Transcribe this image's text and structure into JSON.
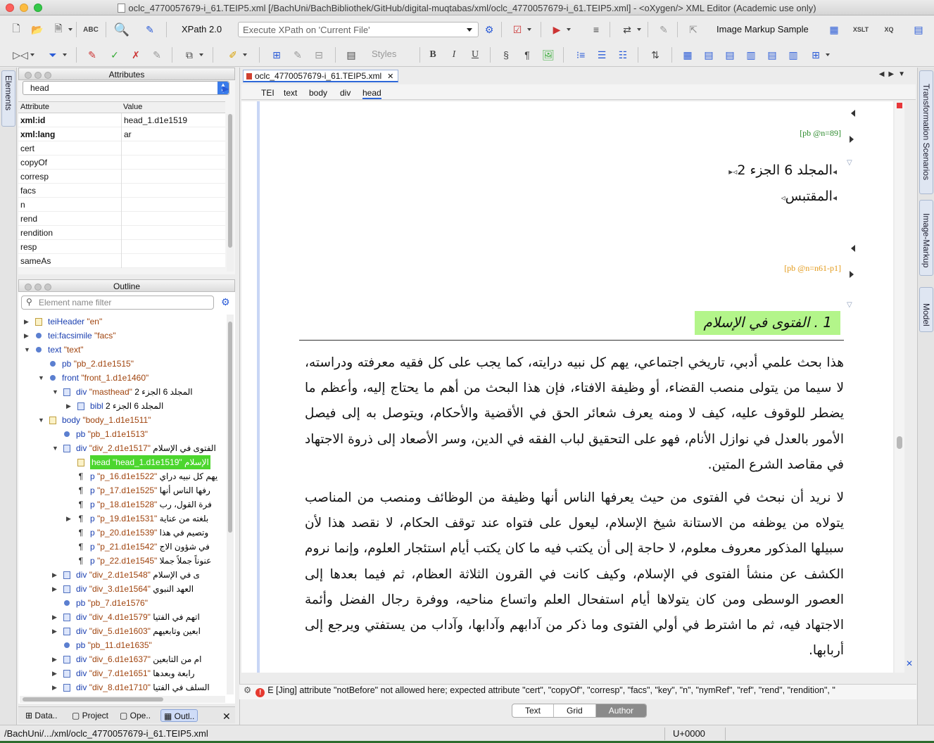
{
  "window": {
    "title": "oclc_4770057679-i_61.TEIP5.xml [/BachUni/BachBibliothek/GitHub/digital-muqtabas/xml/oclc_4770057679-i_61.TEIP5.xml] - <oXygen/> XML Editor (Academic use only)"
  },
  "toolbar": {
    "xpath_version": "XPath 2.0",
    "xpath_placeholder": "Execute XPath on  'Current File'",
    "image_markup": "Image Markup Sample",
    "styles": "Styles"
  },
  "side_tabs": {
    "left": "Elements",
    "right": [
      "Transformation Scenarios",
      "Image-Markup",
      "Model"
    ]
  },
  "attributes_panel": {
    "title": "Attributes",
    "element": "head",
    "columns": [
      "Attribute",
      "Value"
    ],
    "rows": [
      {
        "name": "xml:id",
        "value": "head_1.d1e1519",
        "set": true
      },
      {
        "name": "xml:lang",
        "value": "ar",
        "set": true
      },
      {
        "name": "cert",
        "value": "",
        "set": false
      },
      {
        "name": "copyOf",
        "value": "",
        "set": false
      },
      {
        "name": "corresp",
        "value": "",
        "set": false
      },
      {
        "name": "facs",
        "value": "",
        "set": false
      },
      {
        "name": "n",
        "value": "",
        "set": false
      },
      {
        "name": "rend",
        "value": "",
        "set": false
      },
      {
        "name": "rendition",
        "value": "",
        "set": false
      },
      {
        "name": "resp",
        "value": "",
        "set": false
      },
      {
        "name": "sameAs",
        "value": "",
        "set": false
      }
    ]
  },
  "outline_panel": {
    "title": "Outline",
    "filter_placeholder": "Element name filter",
    "items": [
      {
        "twist": "▶",
        "icon": "elem-y",
        "name": "teiHeader",
        "val": "\"en\"",
        "ar": ""
      },
      {
        "twist": "▶",
        "icon": "dot",
        "name": "tei:facsimile",
        "val": "\"facs\"",
        "ar": ""
      },
      {
        "twist": "▼",
        "icon": "dot",
        "name": "text",
        "val": "\"text\"",
        "ar": ""
      },
      {
        "twist": "",
        "icon": "dot",
        "name": "pb",
        "val": "\"pb_2.d1e1515\"",
        "ar": ""
      },
      {
        "twist": "▼",
        "icon": "dot",
        "name": "front",
        "val": "\"front_1.d1e1460\"",
        "ar": ""
      },
      {
        "twist": "▼",
        "icon": "elem",
        "name": "div",
        "val": "\"masthead\"",
        "ar": "المجلد 6 الجزء 2"
      },
      {
        "twist": "▶",
        "icon": "elem",
        "name": "bibl",
        "val": "",
        "ar": "المجلد 6 الجزء 2"
      },
      {
        "twist": "▼",
        "icon": "elem-y",
        "name": "body",
        "val": "\"body_1.d1e1511\"",
        "ar": ""
      },
      {
        "twist": "",
        "icon": "dot",
        "name": "pb",
        "val": "\"pb_1.d1e1513\"",
        "ar": ""
      },
      {
        "twist": "▼",
        "icon": "elem",
        "name": "div",
        "val": "\"div_2.d1e1517\"",
        "ar": "الفتوى في الإسلام"
      },
      {
        "twist": "",
        "icon": "elem-y",
        "name": "head",
        "val": "\"head_1.d1e1519\"",
        "ar": "الإسلام",
        "selected": true
      },
      {
        "twist": "",
        "icon": "para",
        "name": "p",
        "val": "\"p_16.d1e1522\"",
        "ar": "يهم كل نبيه دراي"
      },
      {
        "twist": "",
        "icon": "para",
        "name": "p",
        "val": "\"p_17.d1e1525\"",
        "ar": "رفها الناس أنها"
      },
      {
        "twist": "",
        "icon": "para",
        "name": "p",
        "val": "\"p_18.d1e1528\"",
        "ar": "فرة القول، رب"
      },
      {
        "twist": "▶",
        "icon": "para",
        "name": "p",
        "val": "\"p_19.d1e1531\"",
        "ar": "بلغته من عناية"
      },
      {
        "twist": "",
        "icon": "para",
        "name": "p",
        "val": "\"p_20.d1e1539\"",
        "ar": "وتصيم في هذا"
      },
      {
        "twist": "",
        "icon": "para",
        "name": "p",
        "val": "\"p_21.d1e1542\"",
        "ar": "في شؤون الاج"
      },
      {
        "twist": "",
        "icon": "para",
        "name": "p",
        "val": "\"p_22.d1e1545\"",
        "ar": "عنوناً جملاً جملا"
      },
      {
        "twist": "▶",
        "icon": "elem",
        "name": "div",
        "val": "\"div_2.d1e1548\"",
        "ar": "ى في الإسلام"
      },
      {
        "twist": "▶",
        "icon": "elem",
        "name": "div",
        "val": "\"div_3.d1e1564\"",
        "ar": "العهد النبوي"
      },
      {
        "twist": "",
        "icon": "dot",
        "name": "pb",
        "val": "\"pb_7.d1e1576\"",
        "ar": ""
      },
      {
        "twist": "▶",
        "icon": "elem",
        "name": "div",
        "val": "\"div_4.d1e1579\"",
        "ar": "اتهم في الفتيا"
      },
      {
        "twist": "▶",
        "icon": "elem",
        "name": "div",
        "val": "\"div_5.d1e1603\"",
        "ar": "ابعين وتابعيهم"
      },
      {
        "twist": "",
        "icon": "dot",
        "name": "pb",
        "val": "\"pb_11.d1e1635\"",
        "ar": ""
      },
      {
        "twist": "▶",
        "icon": "elem",
        "name": "div",
        "val": "\"div_6.d1e1637\"",
        "ar": "ام من التابعين"
      },
      {
        "twist": "▶",
        "icon": "elem",
        "name": "div",
        "val": "\"div_7.d1e1651\"",
        "ar": "رابعة وبعدها"
      },
      {
        "twist": "▶",
        "icon": "elem",
        "name": "div",
        "val": "\"div_8.d1e1710\"",
        "ar": "السلف في الفتيا"
      }
    ]
  },
  "bottom_tabs": [
    "Data..",
    "Project",
    "Ope..",
    "Outl.."
  ],
  "editor": {
    "file_tab": "oclc_4770057679-i_61.TEIP5.xml",
    "breadcrumb": [
      "TEI",
      "text",
      "body",
      "div",
      "head"
    ],
    "pb1": "[pb @n=89]",
    "pb2": "[pb @n=n61-p1]",
    "masthead_line1": "المجلد 6 الجزء 2",
    "masthead_line2": "المقتبس",
    "head": "1 . الفتوى في الإسلام",
    "paragraphs": [
      "هذا بحث علمي أدبي، تاريخي اجتماعي، يهم كل نبيه درايته، كما يجب على كل فقيه معرفته ودراسته، لا سيما من يتولى منصب القضاء، أو وظيفة الافتاء، فإن هذا البحث من أهم ما يحتاج إليه، وأعظم ما يضطر للوقوف عليه، كيف لا ومنه يعرف شعائر الحق في الأقضية والأحكام، ويتوصل به إلى فيصل الأمور بالعدل في نوازل الأنام، فهو على التحقيق لباب الفقه في الدين، وسر الأصعاد إلى ذروة الاجتهاد في مقاصد الشرع المتين.",
      "لا نريد أن نبحث في الفتوى من حيث يعرفها الناس أنها وظيفة من الوظائف ومنصب من المناصب يتولاه من يوظفه من الاستانة شيخ الإسلام، ليعول على فتواه عند توقف الحكام، لا نقصد هذا لأن سبيلها المذكور معروف معلوم، لا حاجة إلى أن يكتب فيه ما كان يكتب أيام استئجار العلوم، وإنما نروم الكشف عن منشأ الفتوى في الإسلام، وكيف كانت في القرون الثلاثة العظام، ثم فيما بعدها إلى العصور الوسطى ومن كان يتولاها أيام استفحال العلم واتساع مناحيه، ووفرة رجال الفضل وأئمة الاجتهاد فيه، ثم ما اشترط في أولي الفتوى وما ذكر من آدابهم وآدابها، وآداب من يستفتي ويرجع إلى أربابها."
    ],
    "problem": "E [Jing] attribute \"notBefore\" not allowed here; expected attribute \"cert\", \"copyOf\", \"corresp\", \"facs\", \"key\", \"n\", \"nymRef\", \"ref\", \"rend\", \"rendition\", \"",
    "modes": [
      "Text",
      "Grid",
      "Author"
    ],
    "active_mode": "Author"
  },
  "status": {
    "path": "/BachUni/.../xml/oclc_4770057679-i_61.TEIP5.xml",
    "unicode": "U+0000"
  }
}
